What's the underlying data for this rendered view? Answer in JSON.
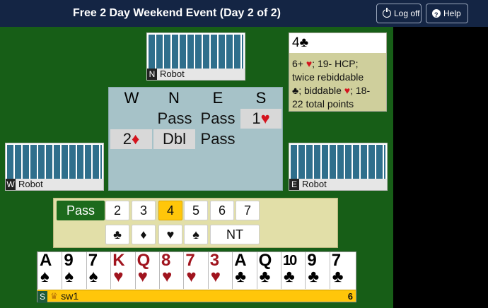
{
  "header": {
    "title": "Free 2 Day Weekend Event (Day 2 of 2)",
    "logoff_label": "Log off",
    "help_label": "Help",
    "logoff_icon": "power-icon",
    "help_icon": "question-icon"
  },
  "players": {
    "north": {
      "seat": "N",
      "name": "Robot"
    },
    "west": {
      "seat": "W",
      "name": "Robot"
    },
    "east": {
      "seat": "E",
      "name": "Robot"
    },
    "south": {
      "seat": "S",
      "name": "sw1",
      "badge": "crown-icon",
      "score": "6"
    }
  },
  "auction": {
    "headers": [
      "W",
      "N",
      "E",
      "S"
    ],
    "row1": {
      "n": "Pass",
      "e": "Pass",
      "s_level": "1",
      "s_suit": "♥"
    },
    "row2": {
      "w_level": "2",
      "w_suit": "♦",
      "n": "Dbl",
      "e": "Pass"
    }
  },
  "explanation": {
    "bid_level": "4",
    "bid_suit": "♣",
    "l1a": "6+ ",
    "l1b": "♥",
    "l1c": "; 19- HCP;",
    "l2": "twice rebiddable",
    "l3a": "♣",
    "l3b": "; biddable ",
    "l3c": "♥",
    "l3d": "; 18-",
    "l4": "22 total points"
  },
  "bid_panel": {
    "pass_label": "Pass",
    "levels": [
      "2",
      "3",
      "4",
      "5",
      "6",
      "7"
    ],
    "selected_level": "4",
    "suits": [
      "♣",
      "♦",
      "♥",
      "♠"
    ],
    "nt_label": "NT"
  },
  "hand": [
    {
      "rank": "A",
      "suit": "♠"
    },
    {
      "rank": "9",
      "suit": "♠"
    },
    {
      "rank": "7",
      "suit": "♠"
    },
    {
      "rank": "K",
      "suit": "♥"
    },
    {
      "rank": "Q",
      "suit": "♥"
    },
    {
      "rank": "8",
      "suit": "♥"
    },
    {
      "rank": "7",
      "suit": "♥"
    },
    {
      "rank": "3",
      "suit": "♥"
    },
    {
      "rank": "A",
      "suit": "♣"
    },
    {
      "rank": "Q",
      "suit": "♣"
    },
    {
      "rank": "10",
      "suit": "♣"
    },
    {
      "rank": "9",
      "suit": "♣"
    },
    {
      "rank": "7",
      "suit": "♣"
    }
  ],
  "colors": {
    "header": "#142544",
    "felt": "#175e17",
    "accent": "#ffc60a",
    "red_suit": "#d4141e"
  }
}
